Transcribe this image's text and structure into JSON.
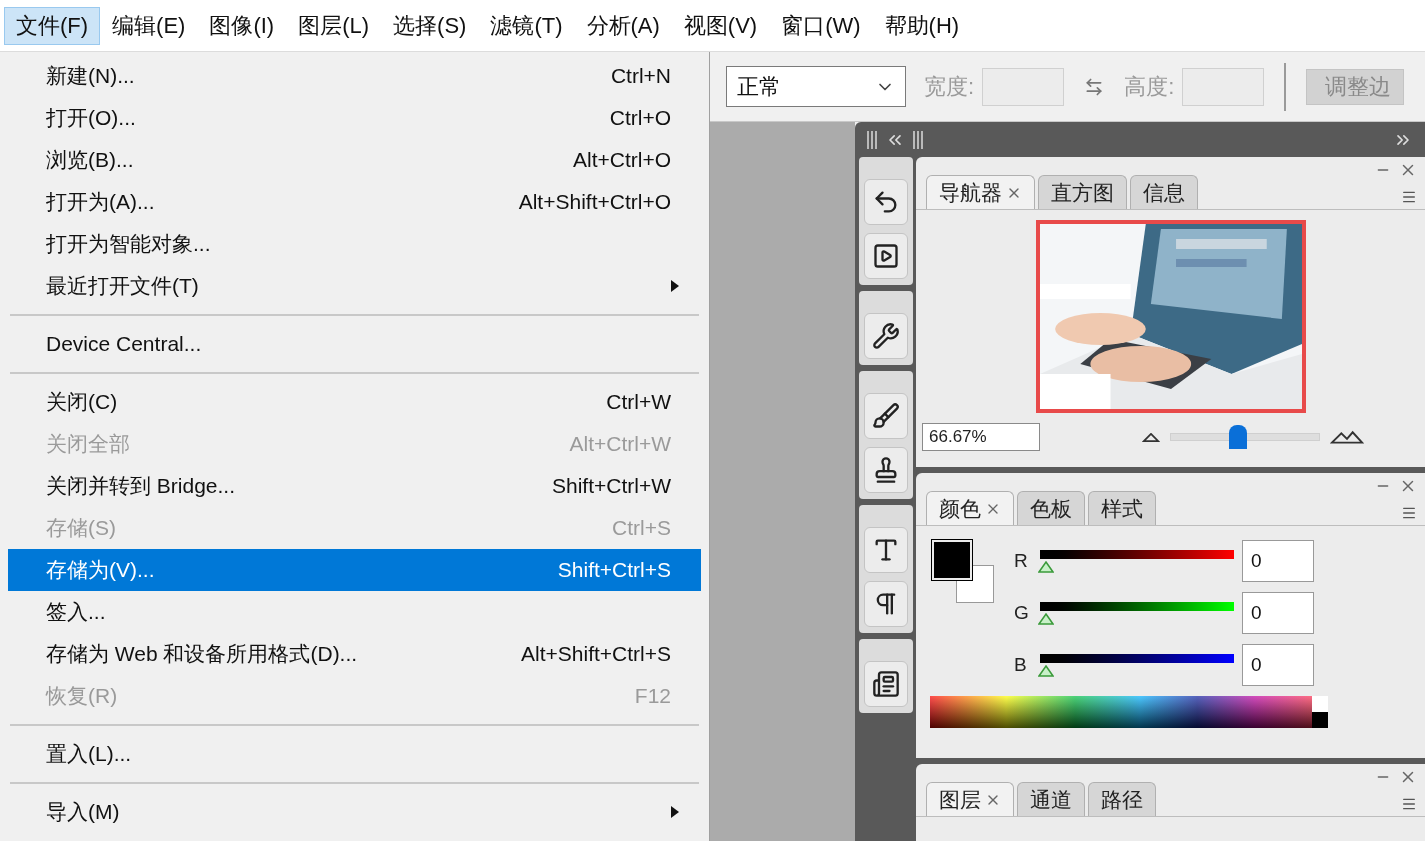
{
  "menubar": [
    {
      "label": "文件(F)",
      "selected": true
    },
    {
      "label": "编辑(E)",
      "selected": false
    },
    {
      "label": "图像(I)",
      "selected": false
    },
    {
      "label": "图层(L)",
      "selected": false
    },
    {
      "label": "选择(S)",
      "selected": false
    },
    {
      "label": "滤镜(T)",
      "selected": false
    },
    {
      "label": "分析(A)",
      "selected": false
    },
    {
      "label": "视图(V)",
      "selected": false
    },
    {
      "label": "窗口(W)",
      "selected": false
    },
    {
      "label": "帮助(H)",
      "selected": false
    }
  ],
  "file_menu": {
    "items": [
      {
        "kind": "item",
        "label": "新建(N)...",
        "shortcut": "Ctrl+N",
        "disabled": false,
        "selected": false,
        "submenu": false
      },
      {
        "kind": "item",
        "label": "打开(O)...",
        "shortcut": "Ctrl+O",
        "disabled": false,
        "selected": false,
        "submenu": false
      },
      {
        "kind": "item",
        "label": "浏览(B)...",
        "shortcut": "Alt+Ctrl+O",
        "disabled": false,
        "selected": false,
        "submenu": false
      },
      {
        "kind": "item",
        "label": "打开为(A)...",
        "shortcut": "Alt+Shift+Ctrl+O",
        "disabled": false,
        "selected": false,
        "submenu": false
      },
      {
        "kind": "item",
        "label": "打开为智能对象...",
        "disabled": false,
        "selected": false,
        "submenu": false
      },
      {
        "kind": "item",
        "label": "最近打开文件(T)",
        "disabled": false,
        "selected": false,
        "submenu": true
      },
      {
        "kind": "separator"
      },
      {
        "kind": "item",
        "label": "Device Central...",
        "disabled": false,
        "selected": false,
        "submenu": false
      },
      {
        "kind": "separator"
      },
      {
        "kind": "item",
        "label": "关闭(C)",
        "shortcut": "Ctrl+W",
        "disabled": false,
        "selected": false,
        "submenu": false
      },
      {
        "kind": "item",
        "label": "关闭全部",
        "shortcut": "Alt+Ctrl+W",
        "disabled": true,
        "selected": false,
        "submenu": false
      },
      {
        "kind": "item",
        "label": "关闭并转到 Bridge...",
        "shortcut": "Shift+Ctrl+W",
        "disabled": false,
        "selected": false,
        "submenu": false
      },
      {
        "kind": "item",
        "label": "存储(S)",
        "shortcut": "Ctrl+S",
        "disabled": true,
        "selected": false,
        "submenu": false
      },
      {
        "kind": "item",
        "label": "存储为(V)...",
        "shortcut": "Shift+Ctrl+S",
        "disabled": false,
        "selected": true,
        "submenu": false
      },
      {
        "kind": "item",
        "label": "签入...",
        "disabled": false,
        "selected": false,
        "submenu": false
      },
      {
        "kind": "item",
        "label": "存储为 Web 和设备所用格式(D)...",
        "shortcut": "Alt+Shift+Ctrl+S",
        "disabled": false,
        "selected": false,
        "submenu": false
      },
      {
        "kind": "item",
        "label": "恢复(R)",
        "shortcut": "F12",
        "disabled": true,
        "selected": false,
        "submenu": false
      },
      {
        "kind": "separator"
      },
      {
        "kind": "item",
        "label": "置入(L)...",
        "disabled": false,
        "selected": false,
        "submenu": false
      },
      {
        "kind": "separator"
      },
      {
        "kind": "item",
        "label": "导入(M)",
        "disabled": false,
        "selected": false,
        "submenu": true
      }
    ]
  },
  "options_bar": {
    "mode": "正常",
    "width_label": "宽度:",
    "height_label": "高度:",
    "button": "调整边"
  },
  "navigator_panel": {
    "tabs": [
      {
        "label": "导航器",
        "selected": true
      },
      {
        "label": "直方图",
        "selected": false
      },
      {
        "label": "信息",
        "selected": false
      }
    ],
    "zoom": "66.67%",
    "zoom_slider": {
      "level": 0.45
    }
  },
  "color_panel": {
    "tabs": [
      {
        "label": "颜色",
        "selected": true
      },
      {
        "label": "色板",
        "selected": false
      },
      {
        "label": "样式",
        "selected": false
      }
    ],
    "channels": [
      {
        "label": "R",
        "level": 0,
        "value": "0"
      },
      {
        "label": "G",
        "level": 0,
        "value": "0"
      },
      {
        "label": "B",
        "level": 0,
        "value": "0"
      }
    ]
  },
  "layers_panel": {
    "tabs": [
      {
        "label": "图层",
        "selected": true
      },
      {
        "label": "通道",
        "selected": false
      },
      {
        "label": "路径",
        "selected": false
      }
    ]
  }
}
